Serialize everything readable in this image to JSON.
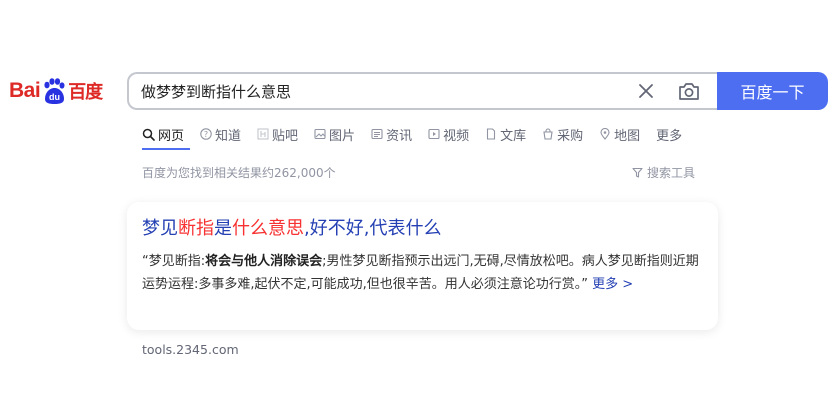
{
  "logo": {
    "text_bai": "Bai",
    "text_du": "du",
    "text_cn": "百度"
  },
  "search": {
    "query": "做梦梦到断指什么意思",
    "button_label": "百度一下"
  },
  "tabs": [
    {
      "label": "网页",
      "icon": "search-icon",
      "active": true
    },
    {
      "label": "知道",
      "icon": "question-icon"
    },
    {
      "label": "贴吧",
      "icon": "tieba-icon"
    },
    {
      "label": "图片",
      "icon": "image-icon"
    },
    {
      "label": "资讯",
      "icon": "news-icon"
    },
    {
      "label": "视频",
      "icon": "video-icon"
    },
    {
      "label": "文库",
      "icon": "document-icon"
    },
    {
      "label": "采购",
      "icon": "shopping-icon"
    },
    {
      "label": "地图",
      "icon": "map-pin-icon"
    },
    {
      "label": "更多"
    }
  ],
  "results_info": {
    "count_text": "百度为您找到相关结果约262,000个",
    "tools_label": "搜索工具"
  },
  "result": {
    "title_parts": [
      {
        "text": "梦见",
        "hl": false
      },
      {
        "text": "断指",
        "hl": true
      },
      {
        "text": "是",
        "hl": false
      },
      {
        "text": "什么意思",
        "hl": true
      },
      {
        "text": ",好不好,代表什么",
        "hl": false
      }
    ],
    "snippet_parts": [
      {
        "text": "“梦见断指:",
        "bold": false
      },
      {
        "text": "将会与他人消除误会",
        "bold": true
      },
      {
        "text": ";男性梦见断指预示出远门,无碍,尽情放松吧。病人梦见断指则近期运势运程:多事多难,起伏不定,可能成功,但也很辛苦。用人必须注意论功行赏。”",
        "bold": false
      }
    ],
    "more_label": "更多 >",
    "source": "tools.2345.com"
  },
  "colors": {
    "accent": "#4e6ef2",
    "highlight": "#f73131",
    "link": "#2440b3",
    "logo_red": "#de2a26",
    "logo_blue": "#2932e1"
  }
}
